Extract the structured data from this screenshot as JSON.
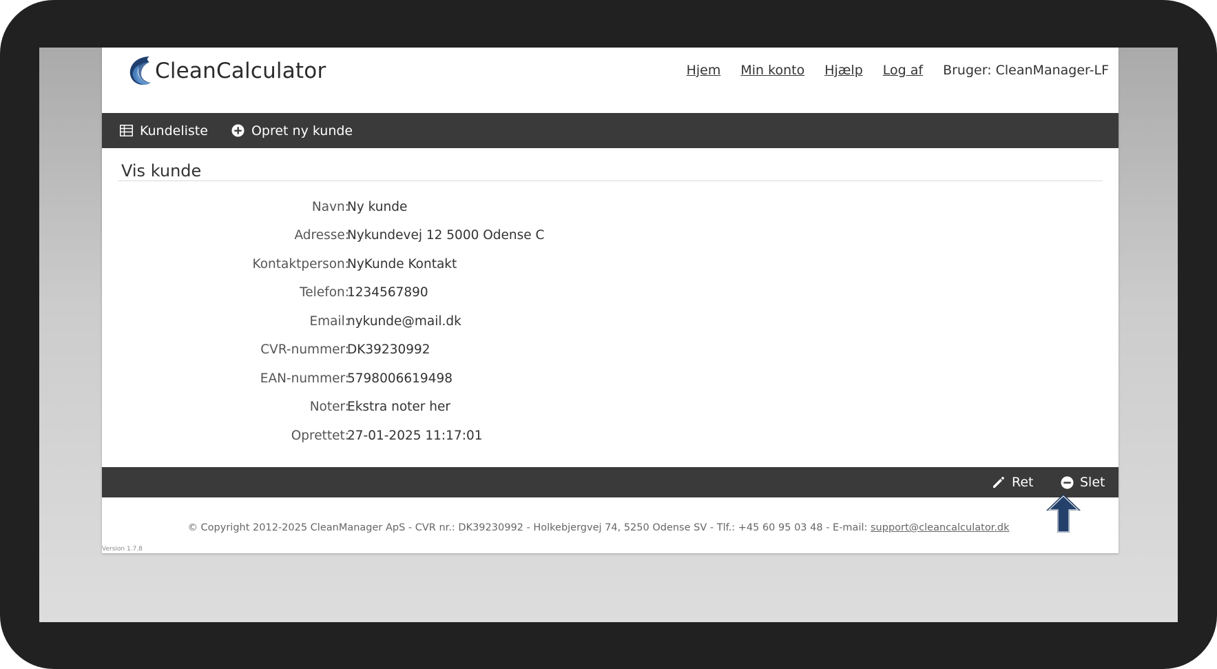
{
  "app": {
    "logo_text": "CleanCalculator"
  },
  "top_nav": {
    "links": [
      "Hjem",
      "Min konto",
      "Hjælp",
      "Log af"
    ],
    "user": "Bruger: CleanManager-LF"
  },
  "toolbar": {
    "customer_list_label": "Kundeliste",
    "create_customer_label": "Opret ny kunde"
  },
  "page": {
    "title": "Vis kunde"
  },
  "customer": {
    "fields": [
      {
        "label": "Navn:",
        "value": "Ny kunde"
      },
      {
        "label": "Adresse:",
        "value": "Nykundevej 12 5000 Odense C"
      },
      {
        "label": "Kontaktperson:",
        "value": "NyKunde Kontakt"
      },
      {
        "label": "Telefon:",
        "value": "1234567890"
      },
      {
        "label": "Email:",
        "value": "nykunde@mail.dk"
      },
      {
        "label": "CVR-nummer:",
        "value": "DK39230992"
      },
      {
        "label": "EAN-nummer:",
        "value": "5798006619498"
      },
      {
        "label": "Noter:",
        "value": "Ekstra noter her"
      },
      {
        "label": "Oprettet:",
        "value": "27-01-2025 11:17:01"
      }
    ]
  },
  "actions": {
    "edit_label": "Ret",
    "delete_label": "Slet"
  },
  "footer": {
    "text": "© Copyright 2012-2025 CleanManager ApS - CVR nr.: DK39230992 - Holkebjergvej 74, 5250 Odense SV - Tlf.: +45 60 95 03 48 - E-mail: ",
    "email": "support@cleancalculator.dk",
    "version": "Version 1.7.8"
  },
  "colors": {
    "frame": "#222122",
    "bar": "#3a3a3a",
    "arrow": "#1f3a5f",
    "logo_blue": "#3f6fa8"
  },
  "icons": {
    "logo": "wave-logo-icon",
    "customer_list": "table-icon",
    "create_customer": "plus-circle-icon",
    "edit": "pencil-icon",
    "delete": "minus-circle-icon",
    "pointer": "up-arrow-icon"
  }
}
